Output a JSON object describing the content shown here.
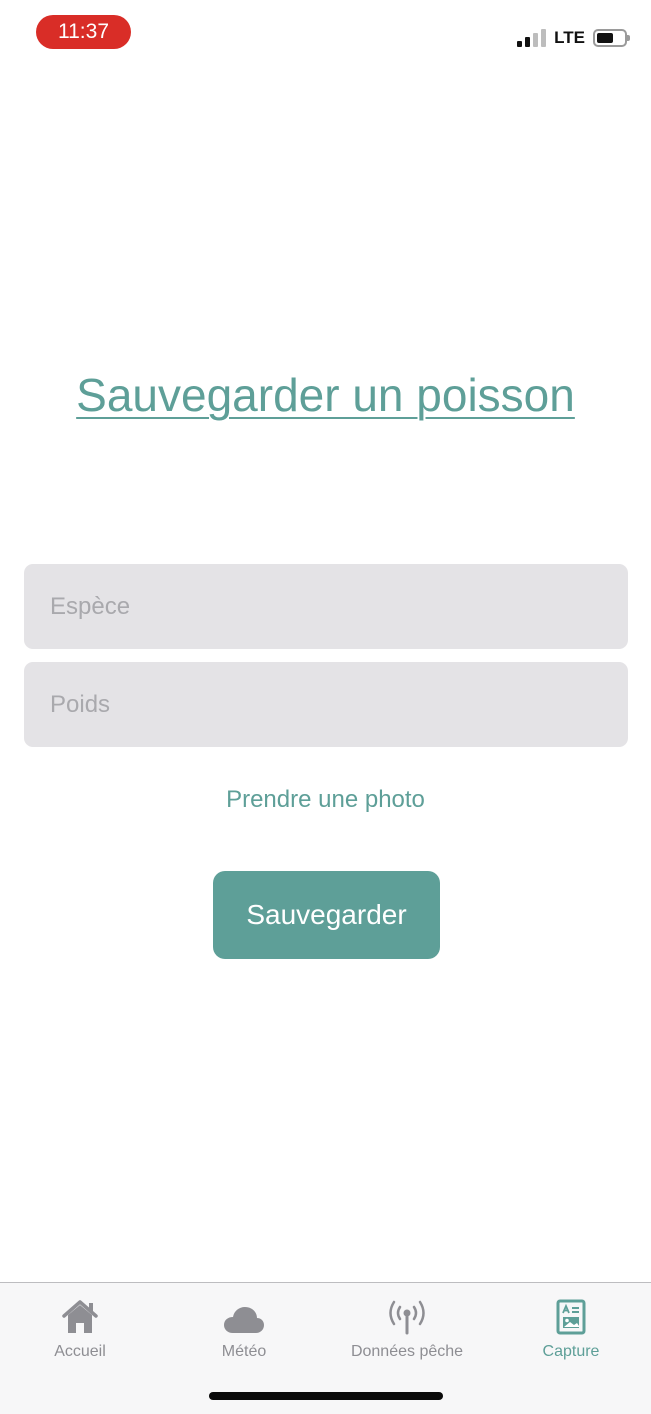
{
  "status_bar": {
    "time": "11:37",
    "network": "LTE",
    "battery_level": 0.6,
    "signal_bars_active": 2,
    "signal_bars_total": 4,
    "time_pill_color": "#d92d27"
  },
  "page": {
    "title": "Sauvegarder un poisson"
  },
  "form": {
    "species_placeholder": "Espèce",
    "species_value": "",
    "weight_placeholder": "Poids",
    "weight_value": "",
    "photo_link_label": "Prendre une photo",
    "save_label": "Sauvegarder"
  },
  "tab_bar": {
    "active": "capture",
    "items": [
      {
        "id": "home",
        "label": "Accueil",
        "icon": "house-icon"
      },
      {
        "id": "weather",
        "label": "Météo",
        "icon": "cloud-icon"
      },
      {
        "id": "data",
        "label": "Données pêche",
        "icon": "antenna-icon"
      },
      {
        "id": "capture",
        "label": "Capture",
        "icon": "id-card-icon"
      }
    ]
  },
  "colors": {
    "accent": "#5e9f98",
    "field_background": "#e4e3e6",
    "inactive_tab": "#8e8e93"
  }
}
